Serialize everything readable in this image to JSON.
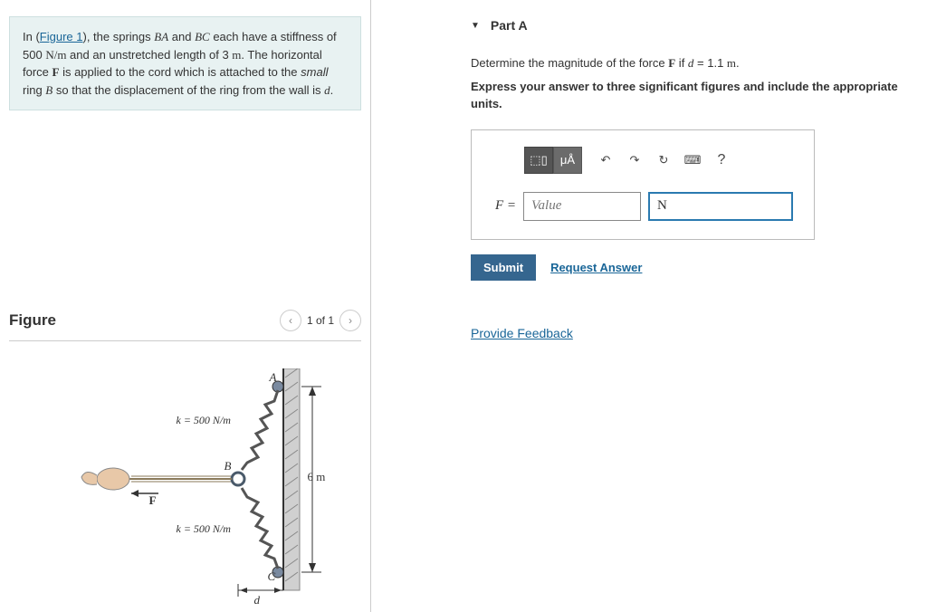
{
  "problem": {
    "intro_prefix": "In (",
    "figure_link": "Figure 1",
    "intro_mid1": "), the springs ",
    "spring1": "BA",
    "and": " and ",
    "spring2": "BC",
    "intro_mid2": " each have a stiffness of 500 ",
    "units_nm": "N/m",
    "intro_mid3": " and an unstretched length of 3 ",
    "units_m": "m",
    "intro_mid4": ". The horizontal force ",
    "force_var": "F",
    "intro_mid5": " is applied to the cord which is attached to the ",
    "small_word": "small",
    "intro_mid6": " ring ",
    "ring_var": "B",
    "intro_mid7": " so that the displacement of the ring from the wall is ",
    "disp_var": "d",
    "intro_end": "."
  },
  "figure": {
    "title": "Figure",
    "nav_prev": "‹",
    "nav_text": "1 of 1",
    "nav_next": "›",
    "label_k1": "k = 500 N/m",
    "label_k2": "k = 500 N/m",
    "label_A": "A",
    "label_B": "B",
    "label_C": "C",
    "label_F": "F",
    "label_d": "d",
    "label_6m": "6 m"
  },
  "partA": {
    "title": "Part A",
    "q_prefix": "Determine the magnitude of the force ",
    "q_var_F": "F",
    "q_mid": " if ",
    "q_var_d": "d",
    "q_eq": " = 1.1 ",
    "q_unit": "m",
    "q_end": ".",
    "instruction": "Express your answer to three significant figures and include the appropriate units.",
    "toolbar": {
      "templates": "⬚▯",
      "special": "μÅ",
      "undo": "↶",
      "redo": "↷",
      "reset": "↻",
      "keyboard": "⌨",
      "help": "?"
    },
    "input_label": "F =",
    "value_placeholder": "Value",
    "unit_value": "N",
    "submit": "Submit",
    "request": "Request Answer"
  },
  "feedback": "Provide Feedback"
}
